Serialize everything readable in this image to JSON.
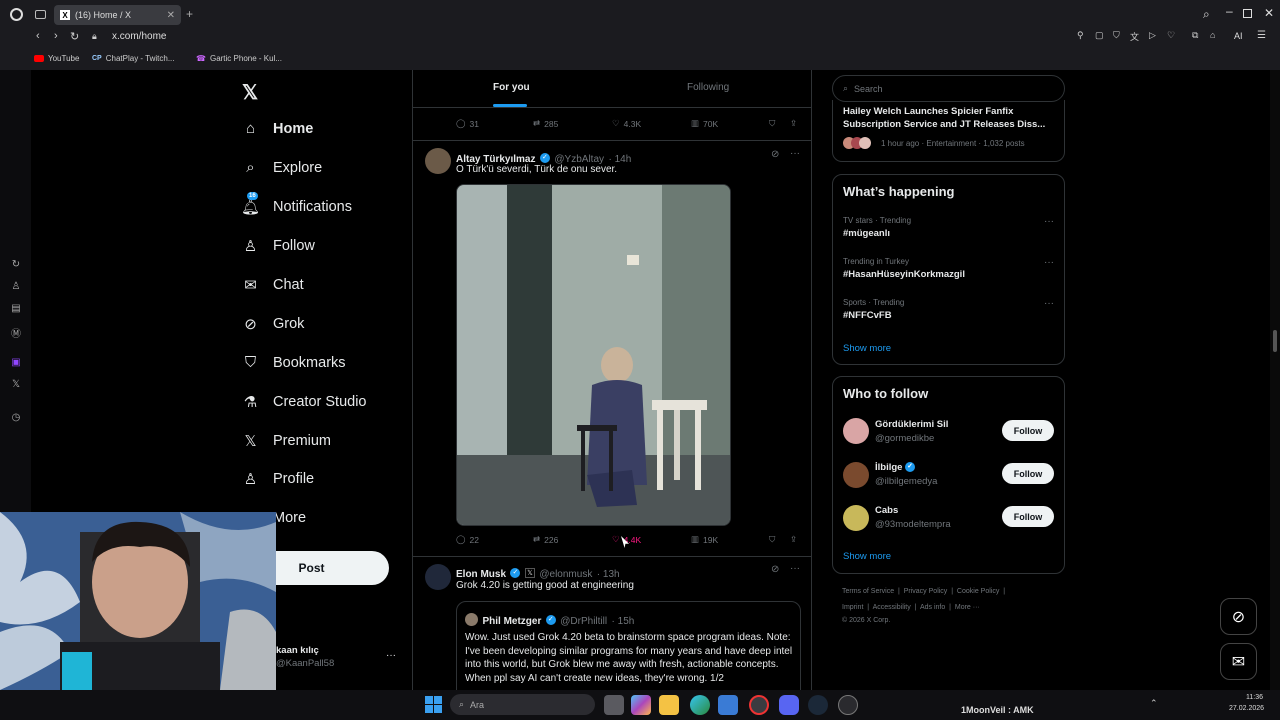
{
  "browser": {
    "tab_title": "(16) Home / X",
    "url": "x.com/home",
    "bookmarks": [
      "YouTube",
      "ChatPlay - Twitch...",
      "Gartic Phone - Kul..."
    ],
    "ai_label": "AI"
  },
  "nav": {
    "items": [
      {
        "label": "Home",
        "icon": "home-icon"
      },
      {
        "label": "Explore",
        "icon": "search-icon"
      },
      {
        "label": "Notifications",
        "icon": "bell-icon",
        "badge": "16"
      },
      {
        "label": "Follow",
        "icon": "person-add-icon"
      },
      {
        "label": "Chat",
        "icon": "mail-icon"
      },
      {
        "label": "Grok",
        "icon": "grok-icon"
      },
      {
        "label": "Bookmarks",
        "icon": "bookmark-icon"
      },
      {
        "label": "Creator Studio",
        "icon": "flask-icon"
      },
      {
        "label": "Premium",
        "icon": "x-icon"
      },
      {
        "label": "Profile",
        "icon": "person-icon"
      },
      {
        "label": "More",
        "icon": "more-icon"
      }
    ],
    "post_label": "Post",
    "account_name": "kaan kılıç",
    "account_handle": "@KaanPall58",
    "account_more": "···"
  },
  "timeline": {
    "tabs": [
      "For you",
      "Following"
    ],
    "prev_tweet_stats": {
      "replies": "31",
      "reposts": "285",
      "likes": "4.3K",
      "views": "70K"
    },
    "tweet1": {
      "name": "Altay Türkyılmaz",
      "handle": "@YzbAltay",
      "time": "· 14h",
      "text": "O Türk'ü severdi, Türk de onu sever.",
      "replies": "22",
      "reposts": "226",
      "likes": "4.4K",
      "views": "19K"
    },
    "tweet2": {
      "name": "Elon Musk",
      "handle": "@elonmusk",
      "time": "· 13h",
      "text": "Grok 4.20 is getting good at engineering",
      "quote_name": "Phil Metzger",
      "quote_handle": "@DrPhiltill",
      "quote_time": "· 15h",
      "quote_text": "Wow. Just used Grok 4.20 beta to brainstorm space program ideas. Note: I've been developing similar programs for many years and have deep intel into this world, but Grok blew me away with fresh, actionable concepts. When ppl say AI can't create new ideas, they're wrong. 1/2"
    }
  },
  "right": {
    "search_placeholder": "Search",
    "news": {
      "title": "Hailey Welch Launches Spicier Fanfix Subscription Service and JT Releases Diss...",
      "meta": "1 hour ago · Entertainment · 1,032 posts"
    },
    "happening_title": "What’s happening",
    "trends": [
      {
        "meta": "TV stars · Trending",
        "name": "#mügeanlı"
      },
      {
        "meta": "Trending in Turkey",
        "name": "#HasanHüseyinKorkmazgil"
      },
      {
        "meta": "Sports · Trending",
        "name": "#NFFCvFB"
      }
    ],
    "show_more": "Show more",
    "wtf_title": "Who to follow",
    "wtf": [
      {
        "name": "Gördüklerimi Sil",
        "handle": "@gormedikbe",
        "verified": false
      },
      {
        "name": "İlbilge",
        "handle": "@ilbilgemedya",
        "verified": true
      },
      {
        "name": "Cabs",
        "handle": "@93modeltempra",
        "verified": false
      }
    ],
    "follow_label": "Follow",
    "footer_line1": [
      "Terms of Service",
      "Privacy Policy",
      "Cookie Policy"
    ],
    "footer_line2": [
      "Imprint",
      "Accessibility",
      "Ads info",
      "More ···"
    ],
    "copyright": "© 2026 X Corp."
  },
  "taskbar": {
    "search_placeholder": "Ara",
    "stream_text": "1MoonVeil : AMK",
    "time": "11:36",
    "date": "27.02.2026"
  },
  "colors": {
    "accent": "#1d9bf0",
    "background": "#000000",
    "like": "#f91880"
  }
}
